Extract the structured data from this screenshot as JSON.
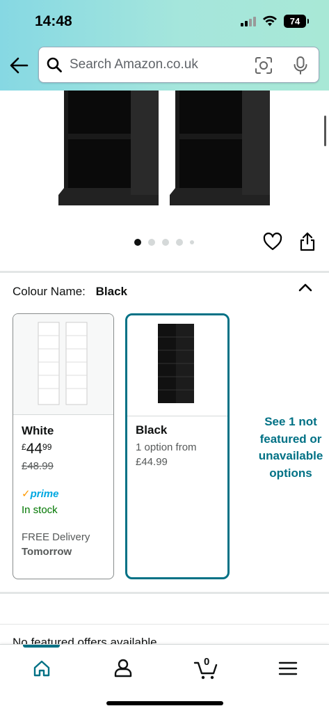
{
  "status_bar": {
    "time": "14:48",
    "battery": "74"
  },
  "search": {
    "placeholder": "Search Amazon.co.uk"
  },
  "gallery": {
    "dot_count": 5,
    "active_dot": 0
  },
  "colour": {
    "label": "Colour Name:",
    "value": "Black"
  },
  "options": [
    {
      "name": "White",
      "price_symbol": "£",
      "price_whole": "44",
      "price_fraction": "99",
      "was_price": "£48.99",
      "prime": "prime",
      "stock": "In stock",
      "delivery_label": "FREE Delivery",
      "delivery_day": "Tomorrow"
    },
    {
      "name": "Black",
      "option_line1": "1 option from",
      "option_line2": "£44.99"
    }
  ],
  "see_more": "See 1 not featured or unavailable options",
  "offers": {
    "text": "No featured offers available"
  },
  "bottom_nav": {
    "cart_count": "0"
  },
  "colors": {
    "accent": "#007185",
    "in_stock": "#007600",
    "prime_blue": "#00a8e1"
  }
}
